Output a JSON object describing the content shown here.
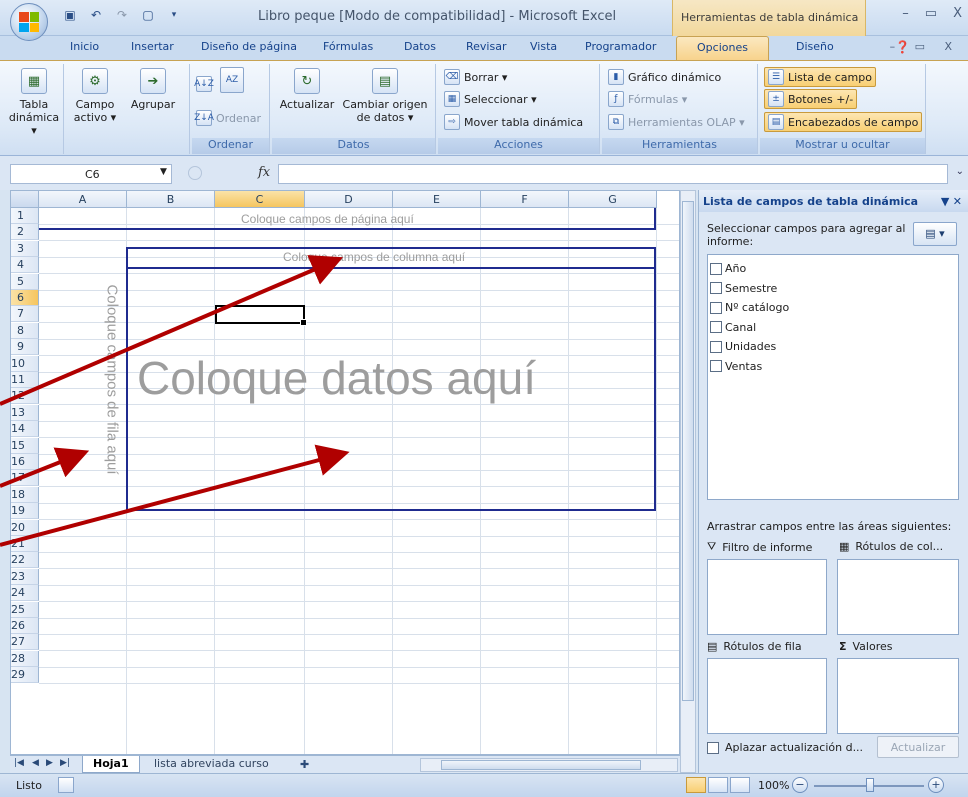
{
  "window": {
    "title": "Libro peque  [Modo de compatibilidad] - Microsoft Excel",
    "context_tab_title": "Herramientas de tabla dinámica",
    "controls": [
      "–",
      "▭",
      "X"
    ]
  },
  "tabs": [
    "Inicio",
    "Insertar",
    "Diseño de página",
    "Fórmulas",
    "Datos",
    "Revisar",
    "Vista",
    "Programador",
    "Opciones",
    "Diseño"
  ],
  "active_tab": "Opciones",
  "ribbon": {
    "pivot_table": "Tabla dinámica ▾",
    "active_field": "Campo activo ▾",
    "group": "Agrupar",
    "sort_asc": "A↓Z",
    "sort_desc": "Z↓A",
    "sort": "Ordenar",
    "refresh": "Actualizar",
    "change_source": "Cambiar origen de datos ▾",
    "clear": "Borrar ▾",
    "select": "Seleccionar ▾",
    "move": "Mover tabla dinámica",
    "pivot_chart": "Gráfico dinámico",
    "formulas": "Fórmulas ▾",
    "olap": "Herramientas OLAP ▾",
    "field_list": "Lista de campo",
    "buttons": "Botones +/-",
    "field_headers": "Encabezados de campo",
    "groups": {
      "ordenar": "Ordenar",
      "datos": "Datos",
      "acciones": "Acciones",
      "herramientas": "Herramientas",
      "mostrar": "Mostrar u ocultar"
    }
  },
  "formula_bar": {
    "name_box": "C6",
    "fx": "fx",
    "value": ""
  },
  "sheet": {
    "columns": [
      "A",
      "B",
      "C",
      "D",
      "E",
      "F",
      "G"
    ],
    "selected_column": "C",
    "rows": [
      "1",
      "2",
      "3",
      "4",
      "5",
      "6",
      "7",
      "8",
      "9",
      "10",
      "11",
      "12",
      "13",
      "14",
      "15",
      "16",
      "17",
      "18",
      "19",
      "20",
      "21",
      "22",
      "23",
      "24",
      "25",
      "26",
      "27",
      "28",
      "29"
    ],
    "selected_row": "6",
    "drop_page": "Coloque campos de página aquí",
    "drop_column": "Coloque campos de columna aquí",
    "drop_data": "Coloque datos aquí",
    "drop_row": "Coloque campos de fila aquí"
  },
  "sheet_tabs": [
    "Hoja1",
    "lista abreviada curso"
  ],
  "active_sheet": "Hoja1",
  "field_list": {
    "title": "Lista de campos de tabla dinámica",
    "choose": "Seleccionar campos para agregar al informe:",
    "fields": [
      "Año",
      "Semestre",
      "Nº catálogo",
      "Canal",
      "Unidades",
      "Ventas"
    ],
    "drag": "Arrastrar campos entre las áreas siguientes:",
    "area_filter": "Filtro de informe",
    "area_columns": "Rótulos de col...",
    "area_rows": "Rótulos de fila",
    "area_values": "Valores",
    "defer": "Aplazar actualización d...",
    "update": "Actualizar"
  },
  "status": {
    "text": "Listo",
    "zoom": "100%"
  },
  "colors": {
    "arrow": "#b00000",
    "pivot_border": "#1f2b8f",
    "placeholder_text": "#9d9d9d"
  }
}
